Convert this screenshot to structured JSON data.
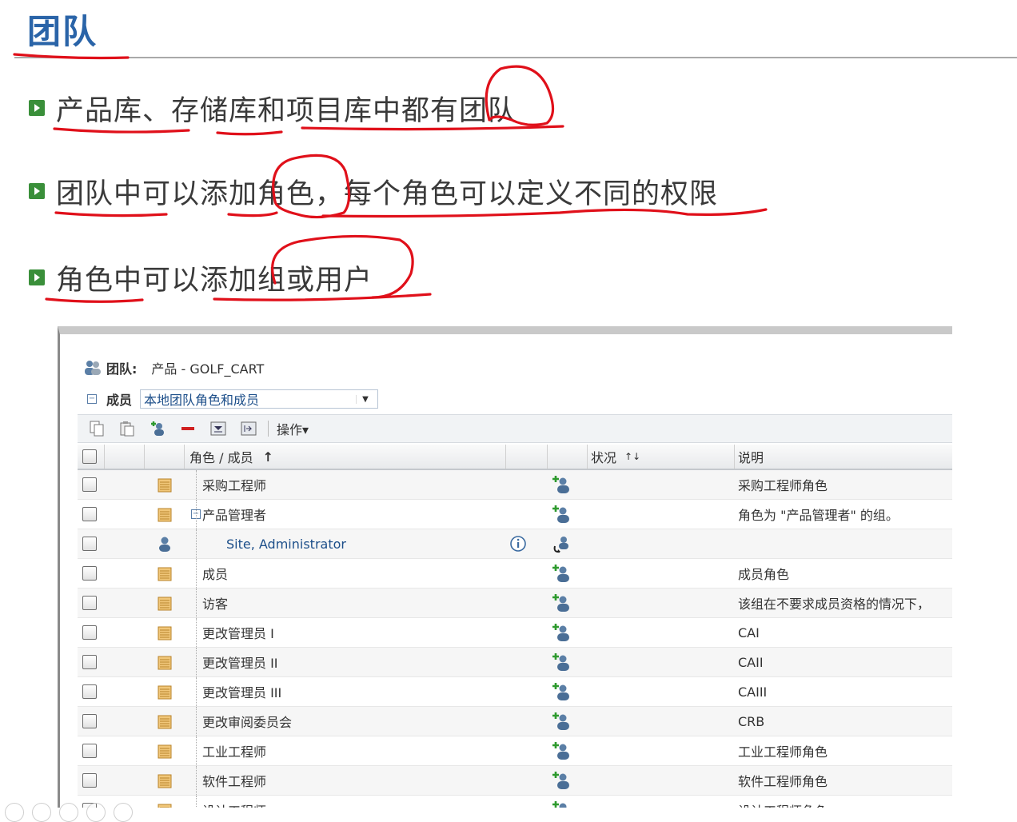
{
  "slide": {
    "title": "团队",
    "bullets": [
      "产品库、存储库和项目库中都有团队",
      "团队中可以添加角色，每个角色可以定义不同的权限",
      "角色中可以添加组或用户"
    ]
  },
  "panel": {
    "team_label": "团队:",
    "team_value": "产品 - GOLF_CART",
    "member_label": "成员",
    "member_select_value": "本地团队角色和成员",
    "toolbar": {
      "actions_label": "操作▾",
      "icons": [
        "copy-icon",
        "paste-icon",
        "add-user-icon",
        "remove-icon",
        "filter-icon",
        "export-icon"
      ]
    },
    "grid": {
      "headers": {
        "role_member": "角色 / 成员",
        "role_sort": "↑",
        "status": "状况",
        "status_sort": "↑↓",
        "description": "说明"
      },
      "rows": [
        {
          "name": "采购工程师",
          "kind": "role",
          "indent": 0,
          "description": "采购工程师角色"
        },
        {
          "name": "产品管理者",
          "kind": "role",
          "indent": 0,
          "expanded": true,
          "description": "角色为 \"产品管理者\" 的组。"
        },
        {
          "name": "Site, Administrator",
          "kind": "user",
          "indent": 1,
          "description": ""
        },
        {
          "name": "成员",
          "kind": "role",
          "indent": 0,
          "description": "成员角色"
        },
        {
          "name": "访客",
          "kind": "role",
          "indent": 0,
          "description": "该组在不要求成员资格的情况下，"
        },
        {
          "name": "更改管理员 I",
          "kind": "role",
          "indent": 0,
          "description": "CAI"
        },
        {
          "name": "更改管理员 II",
          "kind": "role",
          "indent": 0,
          "description": "CAII"
        },
        {
          "name": "更改管理员 III",
          "kind": "role",
          "indent": 0,
          "description": "CAIII"
        },
        {
          "name": "更改审阅委员会",
          "kind": "role",
          "indent": 0,
          "description": "CRB"
        },
        {
          "name": "工业工程师",
          "kind": "role",
          "indent": 0,
          "description": "工业工程师角色"
        },
        {
          "name": "软件工程师",
          "kind": "role",
          "indent": 0,
          "description": "软件工程师角色"
        },
        {
          "name": "设计工程师",
          "kind": "role",
          "indent": 0,
          "description": "设计工程师角色"
        }
      ]
    }
  },
  "colors": {
    "title": "#2a64a8",
    "bullet": "#3a8f3a",
    "ink": "#e0101a",
    "link": "#1d4f8a"
  }
}
